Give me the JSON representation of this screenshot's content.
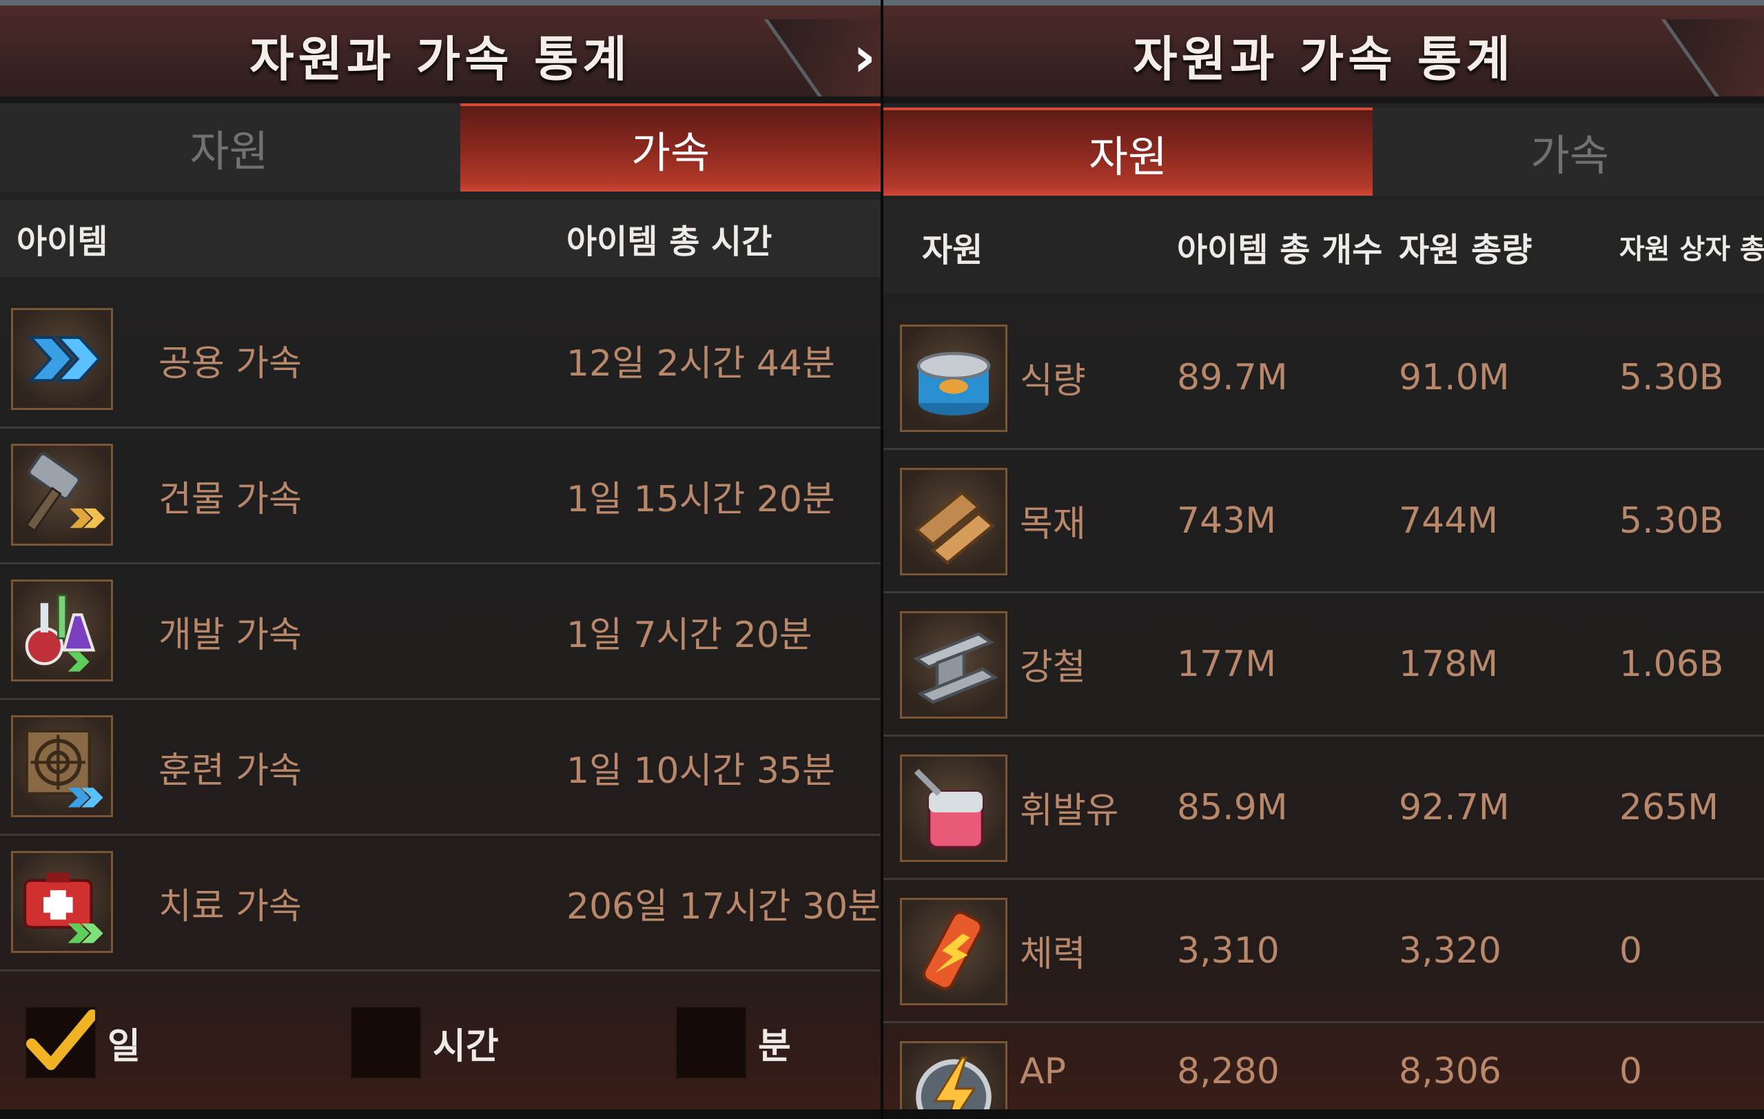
{
  "left_panel": {
    "title": "자원과 가속 통계",
    "tabs": [
      {
        "label": "자원",
        "active": false
      },
      {
        "label": "가속",
        "active": true
      }
    ],
    "columns": {
      "item": "아이템",
      "total_time": "아이템 총 시간"
    },
    "rows": [
      {
        "icon": "double-chevron-icon",
        "name": "공용 가속",
        "time": "12일 2시간 44분"
      },
      {
        "icon": "hammer-icon",
        "name": "건물 가속",
        "time": "1일 15시간 20분"
      },
      {
        "icon": "flask-icon",
        "name": "개발 가속",
        "time": "1일 7시간 20분"
      },
      {
        "icon": "target-icon",
        "name": "훈련 가속",
        "time": "1일 10시간 35분"
      },
      {
        "icon": "medkit-icon",
        "name": "치료 가속",
        "time": "206일 17시간 30분"
      }
    ],
    "filters": [
      {
        "label": "일",
        "checked": true
      },
      {
        "label": "시간",
        "checked": false
      },
      {
        "label": "분",
        "checked": false
      }
    ]
  },
  "right_panel": {
    "title": "자원과 가속 통계",
    "tabs": [
      {
        "label": "자원",
        "active": true
      },
      {
        "label": "가속",
        "active": false
      }
    ],
    "columns": {
      "resource": "자원",
      "item_count": "아이템 총 개수",
      "total": "자원 총량",
      "box": "자원 상자 총"
    },
    "rows": [
      {
        "icon": "food-can-icon",
        "name": "식량",
        "item_count": "89.7M",
        "total": "91.0M",
        "box": "5.30B"
      },
      {
        "icon": "wood-planks-icon",
        "name": "목재",
        "item_count": "743M",
        "total": "744M",
        "box": "5.30B"
      },
      {
        "icon": "steel-beam-icon",
        "name": "강철",
        "item_count": "177M",
        "total": "178M",
        "box": "1.06B"
      },
      {
        "icon": "fuel-can-icon",
        "name": "휘발유",
        "item_count": "85.9M",
        "total": "92.7M",
        "box": "265M"
      },
      {
        "icon": "energy-drink-icon",
        "name": "체력",
        "item_count": "3,310",
        "total": "3,320",
        "box": "0"
      },
      {
        "icon": "lightning-icon",
        "name": "AP",
        "item_count": "8,280",
        "total": "8,306",
        "box": "0"
      }
    ]
  },
  "colors": {
    "accent_red": "#b33a2a",
    "value_text": "#b9876a",
    "header_text": "#eeeae6",
    "check": "#f0b323"
  }
}
